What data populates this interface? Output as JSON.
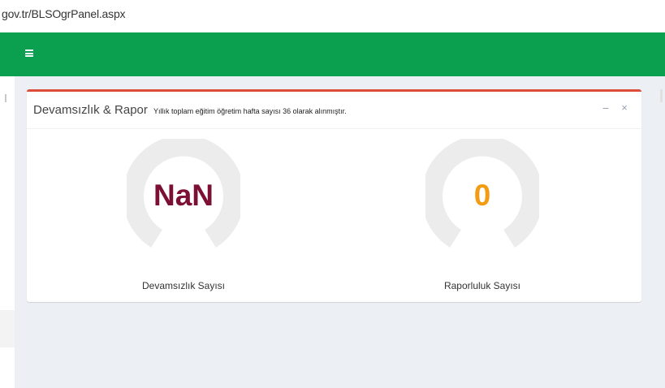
{
  "browser": {
    "url": "gov.tr/BLSOgrPanel.aspx"
  },
  "topbar": {
    "color": "#0aa04f",
    "menu_icon": "hamburger-menu-icon"
  },
  "box": {
    "border_color": "#dd4b39",
    "title": "Devamsızlık & Rapor",
    "note": "Yıllık toplam eğitim öğretim hafta sayısı 36 olarak alınmıştır.",
    "tools": {
      "minimize": "−",
      "close": "×"
    }
  },
  "gauges": [
    {
      "value": "NaN",
      "label": "Devamsızlık Sayısı",
      "value_color": "#7b1034",
      "fill_fraction": 0
    },
    {
      "value": "0",
      "label": "Raporluluk Sayısı",
      "value_color": "#f39c12",
      "fill_fraction": 0
    }
  ]
}
